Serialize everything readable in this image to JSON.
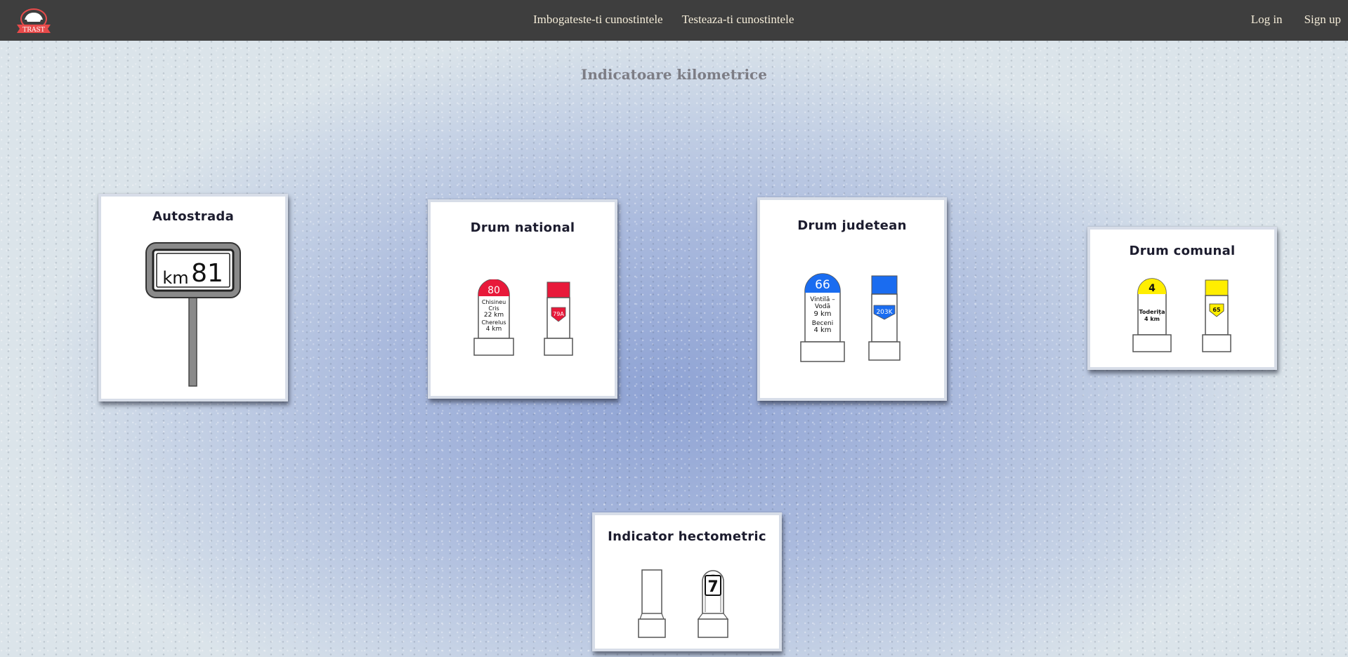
{
  "nav": {
    "logo_text": "TRAST",
    "links_center": [
      "Imbogateste-ti cunostintele",
      "Testeaza-ti cunostintele"
    ],
    "links_right": [
      "Log in",
      "Sign up"
    ]
  },
  "page": {
    "title": "Indicatoare kilometrice"
  },
  "cards": [
    {
      "title": "Autostrada",
      "sign": {
        "prefix": "km",
        "number": "81"
      }
    },
    {
      "title": "Drum national",
      "accent_color": "#e8193a",
      "sign_left": {
        "number": "80",
        "lines_top": [
          "Chisineu",
          "Cris",
          "22 km"
        ],
        "lines_bottom": [
          "Cherelus",
          "4 km"
        ]
      },
      "sign_right": {
        "code": "79A"
      }
    },
    {
      "title": "Drum judetean",
      "accent_color": "#1a6cf0",
      "sign_left": {
        "number": "66",
        "lines_top": [
          "Vintilă –",
          "Vodă",
          "9 km"
        ],
        "lines_bottom": [
          "Beceni",
          "4 km"
        ]
      },
      "sign_right": {
        "code": "203K"
      }
    },
    {
      "title": "Drum comunal",
      "accent_color": "#ffee00",
      "sign_left": {
        "number": "4",
        "lines_top": [
          "Toderița",
          "4 km"
        ]
      },
      "sign_right": {
        "code": "65"
      }
    },
    {
      "title": "Indicator hectometric",
      "sign_right": {
        "number": "7"
      }
    }
  ]
}
